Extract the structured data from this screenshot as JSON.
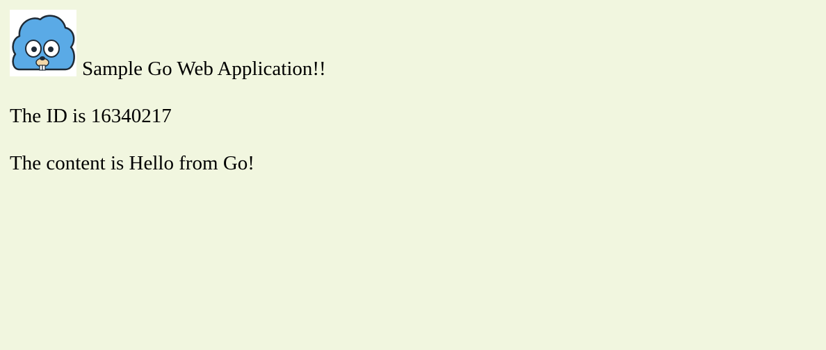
{
  "header": {
    "logo_icon": "cloud-gopher-logo-icon",
    "title": "Sample Go Web Application!!"
  },
  "details": {
    "id_text": "The ID is 16340217",
    "content_text": "The content is Hello from Go!"
  },
  "colors": {
    "background": "#f1f6df",
    "logo_blue": "#5aaae6"
  }
}
